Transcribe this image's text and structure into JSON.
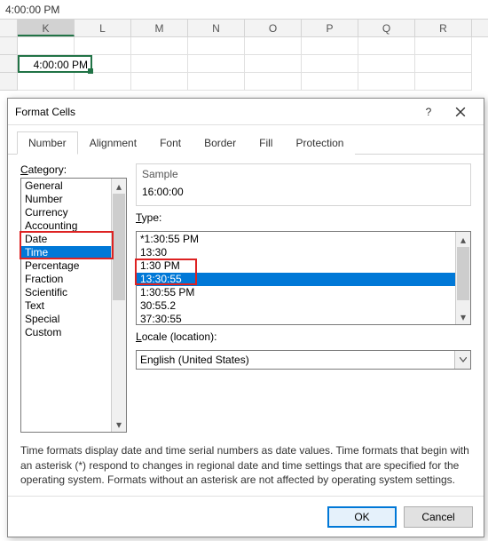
{
  "formula_bar": {
    "value": "4:00:00 PM"
  },
  "columns": [
    "K",
    "L",
    "M",
    "N",
    "O",
    "P",
    "Q",
    "R"
  ],
  "selected_cell": {
    "value": "4:00:00 PM"
  },
  "dialog": {
    "title": "Format Cells",
    "tabs": [
      "Number",
      "Alignment",
      "Font",
      "Border",
      "Fill",
      "Protection"
    ],
    "active_tab": "Number",
    "category_label": "Category:",
    "categories": [
      "General",
      "Number",
      "Currency",
      "Accounting",
      "Date",
      "Time",
      "Percentage",
      "Fraction",
      "Scientific",
      "Text",
      "Special",
      "Custom"
    ],
    "selected_category": "Time",
    "sample_label": "Sample",
    "sample_value": "16:00:00",
    "type_label": "Type:",
    "types": [
      "*1:30:55 PM",
      "13:30",
      "1:30 PM",
      "13:30:55",
      "1:30:55 PM",
      "30:55.2",
      "37:30:55"
    ],
    "selected_type": "13:30:55",
    "locale_label": "Locale (location):",
    "locale_value": "English (United States)",
    "note": "Time formats display date and time serial numbers as date values.  Time formats that begin with an asterisk (*) respond to changes in regional date and time settings that are specified for the operating system. Formats without an asterisk are not affected by operating system settings.",
    "ok_label": "OK",
    "cancel_label": "Cancel",
    "help_tooltip": "?",
    "close_tooltip": "Close"
  }
}
